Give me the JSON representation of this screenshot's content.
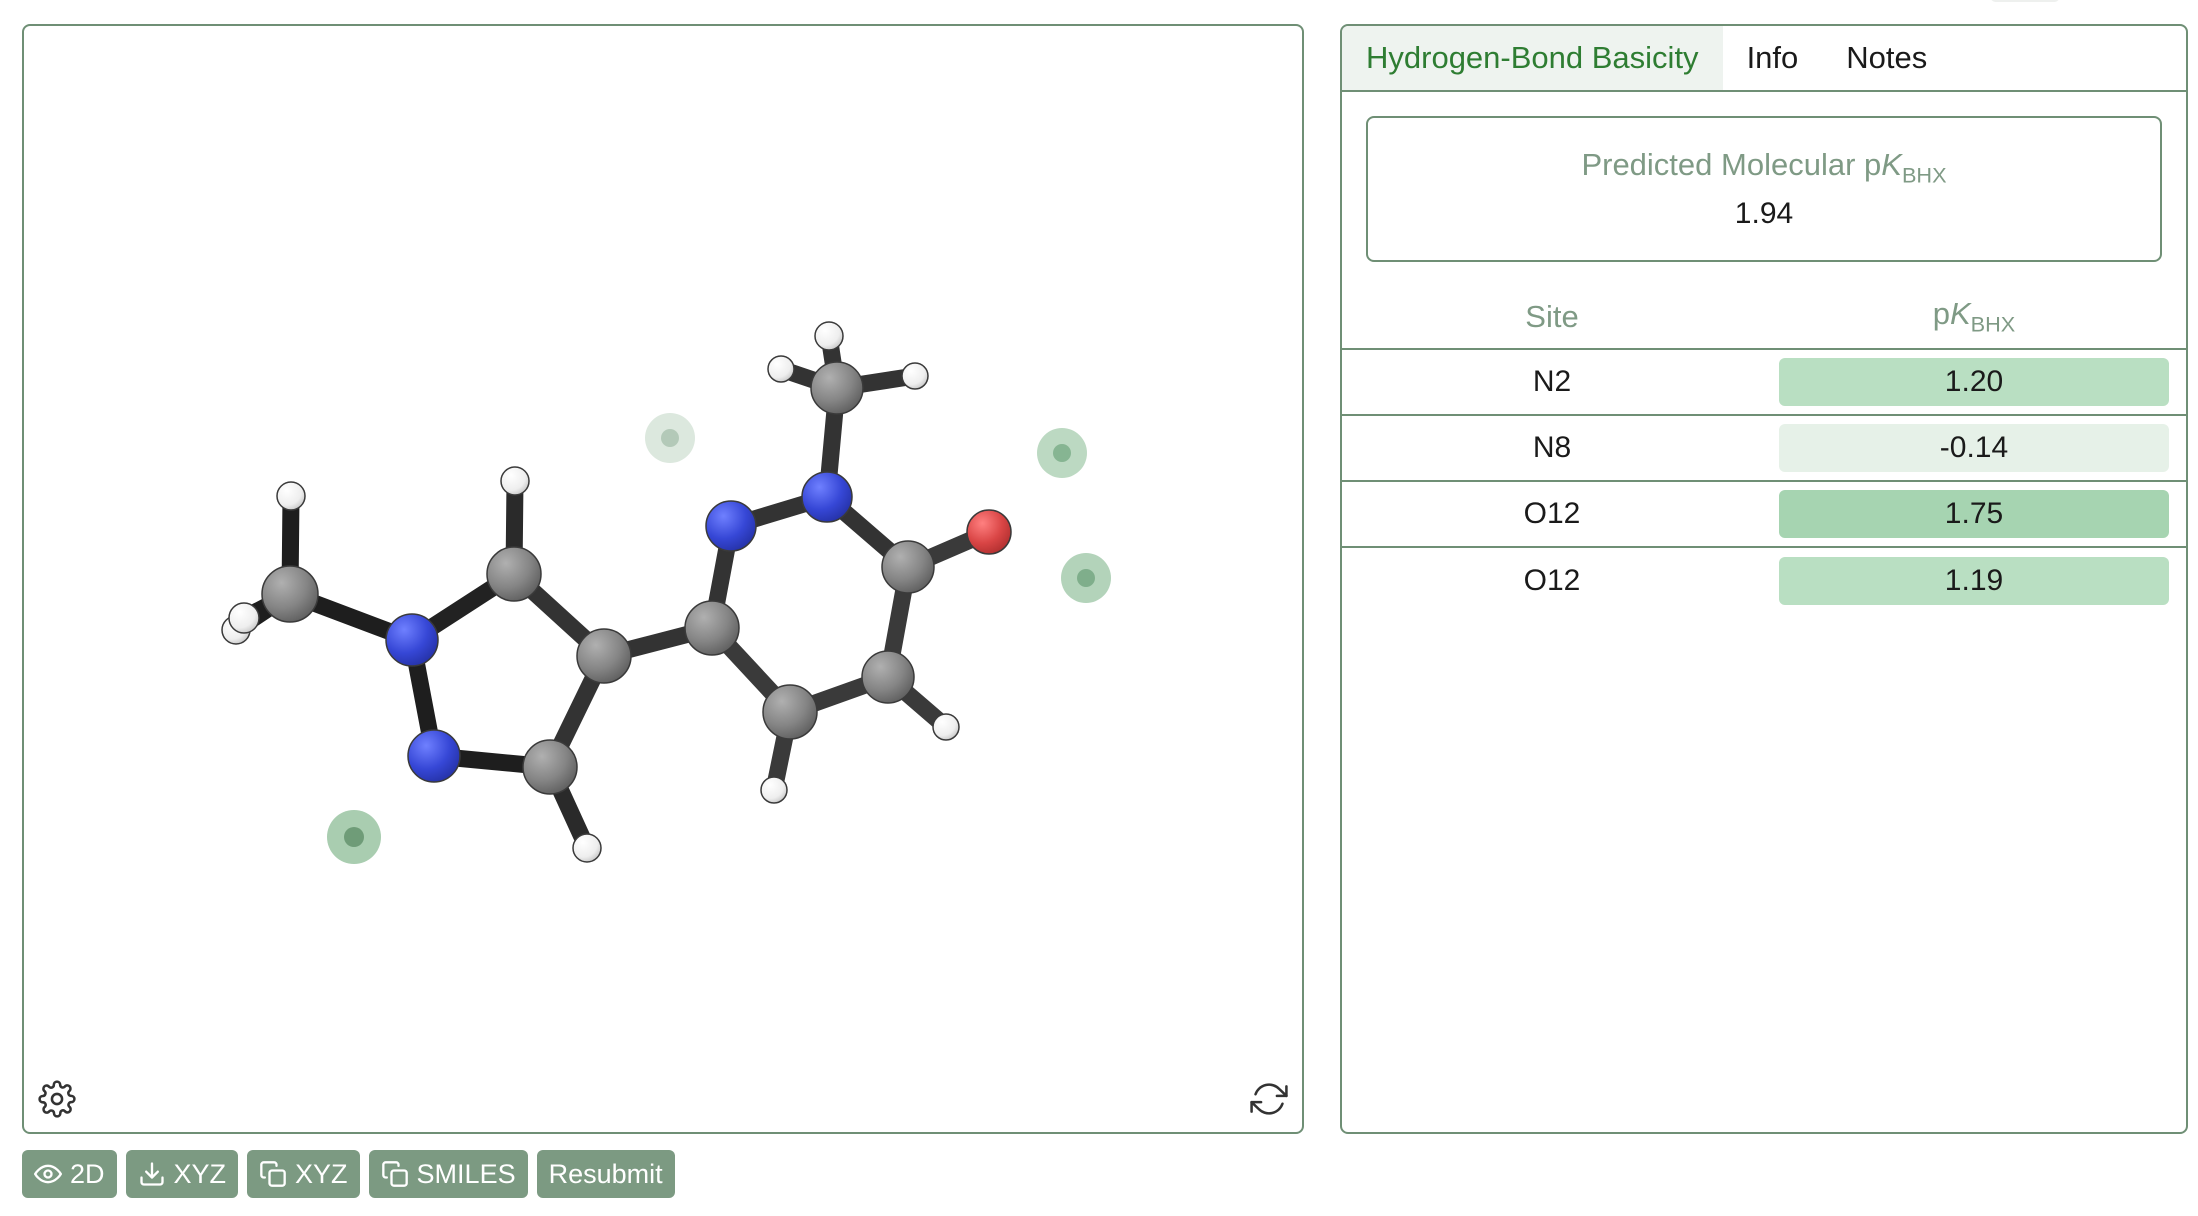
{
  "viewer": {
    "atom_colors": {
      "C": "#808080",
      "N": "#3a4fd9",
      "O": "#d94545",
      "H": "#f2f2f2",
      "site": "#a9cdb0",
      "site_core": "#6f9c78",
      "site_faint": "#dce8de"
    },
    "atoms": {
      "c1": "C",
      "h1a": "H",
      "h1b": "H",
      "h1c": "H",
      "n1": "N",
      "n2": "N",
      "c2": "C",
      "h2": "H",
      "c3": "C",
      "h3": "H",
      "c4": "C",
      "c5": "C",
      "n3": "N",
      "n4": "N",
      "c6": "C",
      "ha": "H",
      "hb": "H",
      "hc": "H",
      "c7": "C",
      "o1": "O",
      "c8": "C",
      "h8": "H",
      "c9": "C",
      "h9": "H"
    },
    "bonds": [
      [
        "c1",
        "h1a"
      ],
      [
        "c1",
        "h1b"
      ],
      [
        "c1",
        "h1c"
      ],
      [
        "c1",
        "n1"
      ],
      [
        "n1",
        "c2"
      ],
      [
        "n1",
        "n2"
      ],
      [
        "c2",
        "h2"
      ],
      [
        "c2",
        "c4"
      ],
      [
        "n2",
        "c3"
      ],
      [
        "c3",
        "c4"
      ],
      [
        "c3",
        "h3"
      ],
      [
        "c4",
        "c5"
      ],
      [
        "c5",
        "n3"
      ],
      [
        "c5",
        "c9"
      ],
      [
        "n3",
        "n4"
      ],
      [
        "n4",
        "c6"
      ],
      [
        "c6",
        "ha"
      ],
      [
        "c6",
        "hb"
      ],
      [
        "c6",
        "hc"
      ],
      [
        "n4",
        "c7"
      ],
      [
        "c7",
        "o1"
      ],
      [
        "c7",
        "c8"
      ],
      [
        "c8",
        "c9"
      ],
      [
        "c8",
        "h8"
      ],
      [
        "c9",
        "h9"
      ]
    ],
    "site_markers": [
      "s1",
      "s2",
      "s3",
      "s4"
    ],
    "settings_icon": "gear-icon",
    "reset_icon": "refresh-icon"
  },
  "toolbar": {
    "view2d": {
      "icon": "eye-icon",
      "label": "2D"
    },
    "download_xyz": {
      "icon": "download-icon",
      "label": "XYZ"
    },
    "copy_xyz": {
      "icon": "copy-icon",
      "label": "XYZ"
    },
    "copy_smiles": {
      "icon": "copy-icon",
      "label": "SMILES"
    },
    "resubmit": {
      "label": "Resubmit"
    }
  },
  "panel": {
    "tabs": [
      {
        "label": "Hydrogen-Bond Basicity",
        "active": true
      },
      {
        "label": "Info",
        "active": false
      },
      {
        "label": "Notes",
        "active": false
      }
    ],
    "summary": {
      "title_prefix": "Predicted Molecular p",
      "title_k": "K",
      "title_sub": "BHX",
      "value": "1.94"
    },
    "table": {
      "site_header": "Site",
      "value_header_p": "p",
      "value_header_k": "K",
      "value_header_sub": "BHX",
      "rows": [
        {
          "site": "N2",
          "value": "1.20",
          "color": "#b9dfc2"
        },
        {
          "site": "N8",
          "value": "-0.14",
          "color": "#e6f1e8"
        },
        {
          "site": "O12",
          "value": "1.75",
          "color": "#a6d4b1"
        },
        {
          "site": "O12",
          "value": "1.19",
          "color": "#b9dfc2"
        }
      ]
    }
  }
}
